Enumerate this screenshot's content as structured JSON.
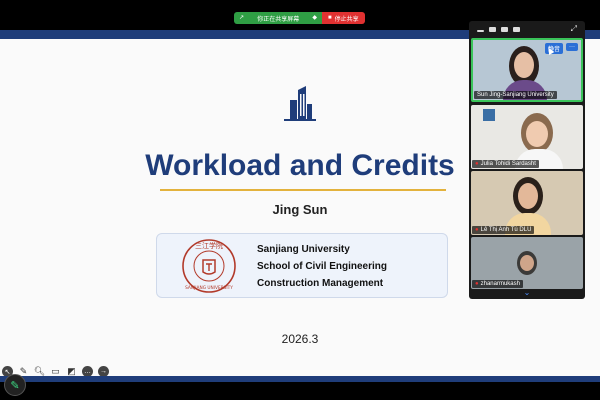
{
  "share_bar": {
    "status_text": "你正在共享屏幕",
    "stop_text": "停止共享",
    "colors": {
      "status": "#2f9e44",
      "stop": "#e03131"
    }
  },
  "slide": {
    "title": "Workload and Credits",
    "author": "Jing Sun",
    "institution_lines": [
      "Sanjiang University",
      "School of Civil Engineering",
      "Construction Management"
    ],
    "seal_chars": "三江学院",
    "seal_latin": "SANJIANG UNIVERSITY",
    "date": "2026.3",
    "colors": {
      "title": "#1f3d7a",
      "rule": "#e3b23c",
      "stripe": "#1f3d7a"
    }
  },
  "participants": [
    {
      "name": "Sun Jing-Sanjiang University",
      "muted": false,
      "active_speaker": true
    },
    {
      "name": "Julia Tohidi Sardasht",
      "muted": true,
      "active_speaker": false
    },
    {
      "name": "Lê Thị Anh Tú DLU",
      "muted": true,
      "active_speaker": false
    },
    {
      "name": "zhanarmukash",
      "muted": true,
      "active_speaker": false
    }
  ],
  "tile_controls": {
    "mute_label": "静音",
    "more_label": "···"
  },
  "toolbar_icons": [
    "pointer-icon",
    "pen-icon",
    "zoom-icon",
    "caption-icon",
    "camera-off-icon",
    "more-icon",
    "next-icon"
  ]
}
